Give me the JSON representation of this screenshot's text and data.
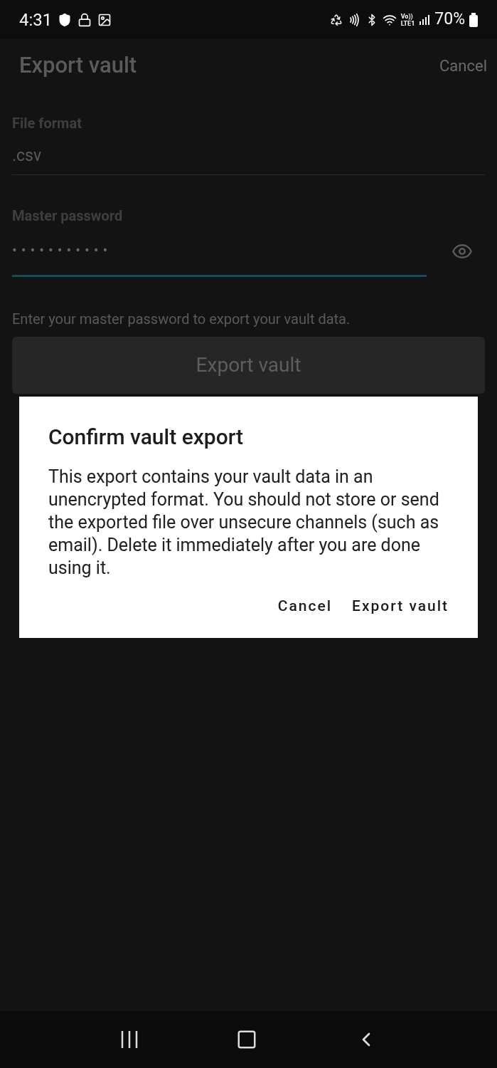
{
  "status_bar": {
    "time": "4:31",
    "volte_top": "Vo))",
    "volte_bottom": "LTE1",
    "battery": "70%"
  },
  "header": {
    "title": "Export vault",
    "action": "Cancel"
  },
  "form": {
    "file_format": {
      "label": "File format",
      "value": ".csv"
    },
    "master_password": {
      "label": "Master password",
      "value": "•••••••••••",
      "focused": true
    },
    "hint": "Enter your master password to export your vault data.",
    "button": "Export vault"
  },
  "dialog": {
    "title": "Confirm vault export",
    "message": "This export contains your vault data in an unencrypted format. You should not store or send the exported file over unsecure channels (such as email). Delete it immediately after you are done using it.",
    "buttons": [
      "Cancel",
      "Export vault"
    ]
  }
}
